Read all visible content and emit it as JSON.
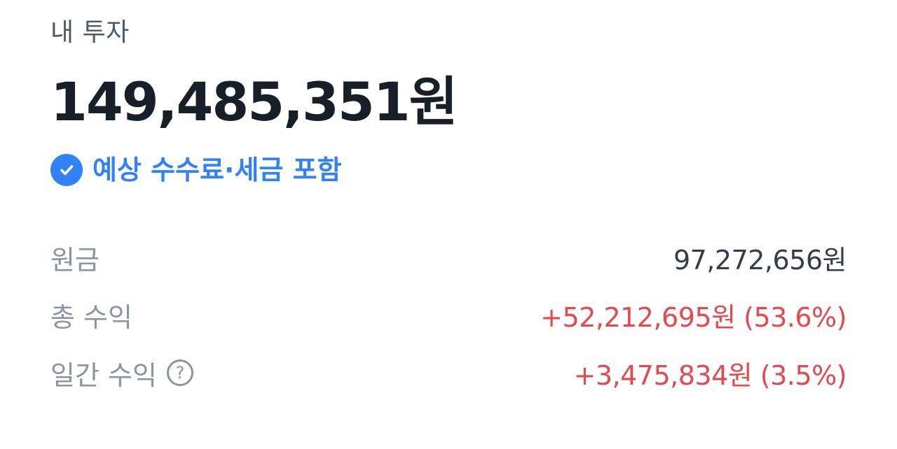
{
  "header": {
    "title": "내 투자"
  },
  "summary": {
    "total_value": "149,485,351원",
    "fee_tax_badge": "예상 수수료·세금 포함",
    "badge_icon": "check-circle-icon",
    "accent_color": "#3182f6"
  },
  "details": {
    "principal": {
      "label": "원금",
      "value": "97,272,656원"
    },
    "total_profit": {
      "label": "총 수익",
      "value": "+52,212,695원 (53.6%)"
    },
    "daily_profit": {
      "label": "일간 수익",
      "value": "+3,475,834원 (3.5%)",
      "help_icon": "question-circle-icon",
      "help_glyph": "?"
    }
  },
  "colors": {
    "positive": "#e5484d",
    "label": "#8b95a1",
    "text": "#191f28"
  }
}
